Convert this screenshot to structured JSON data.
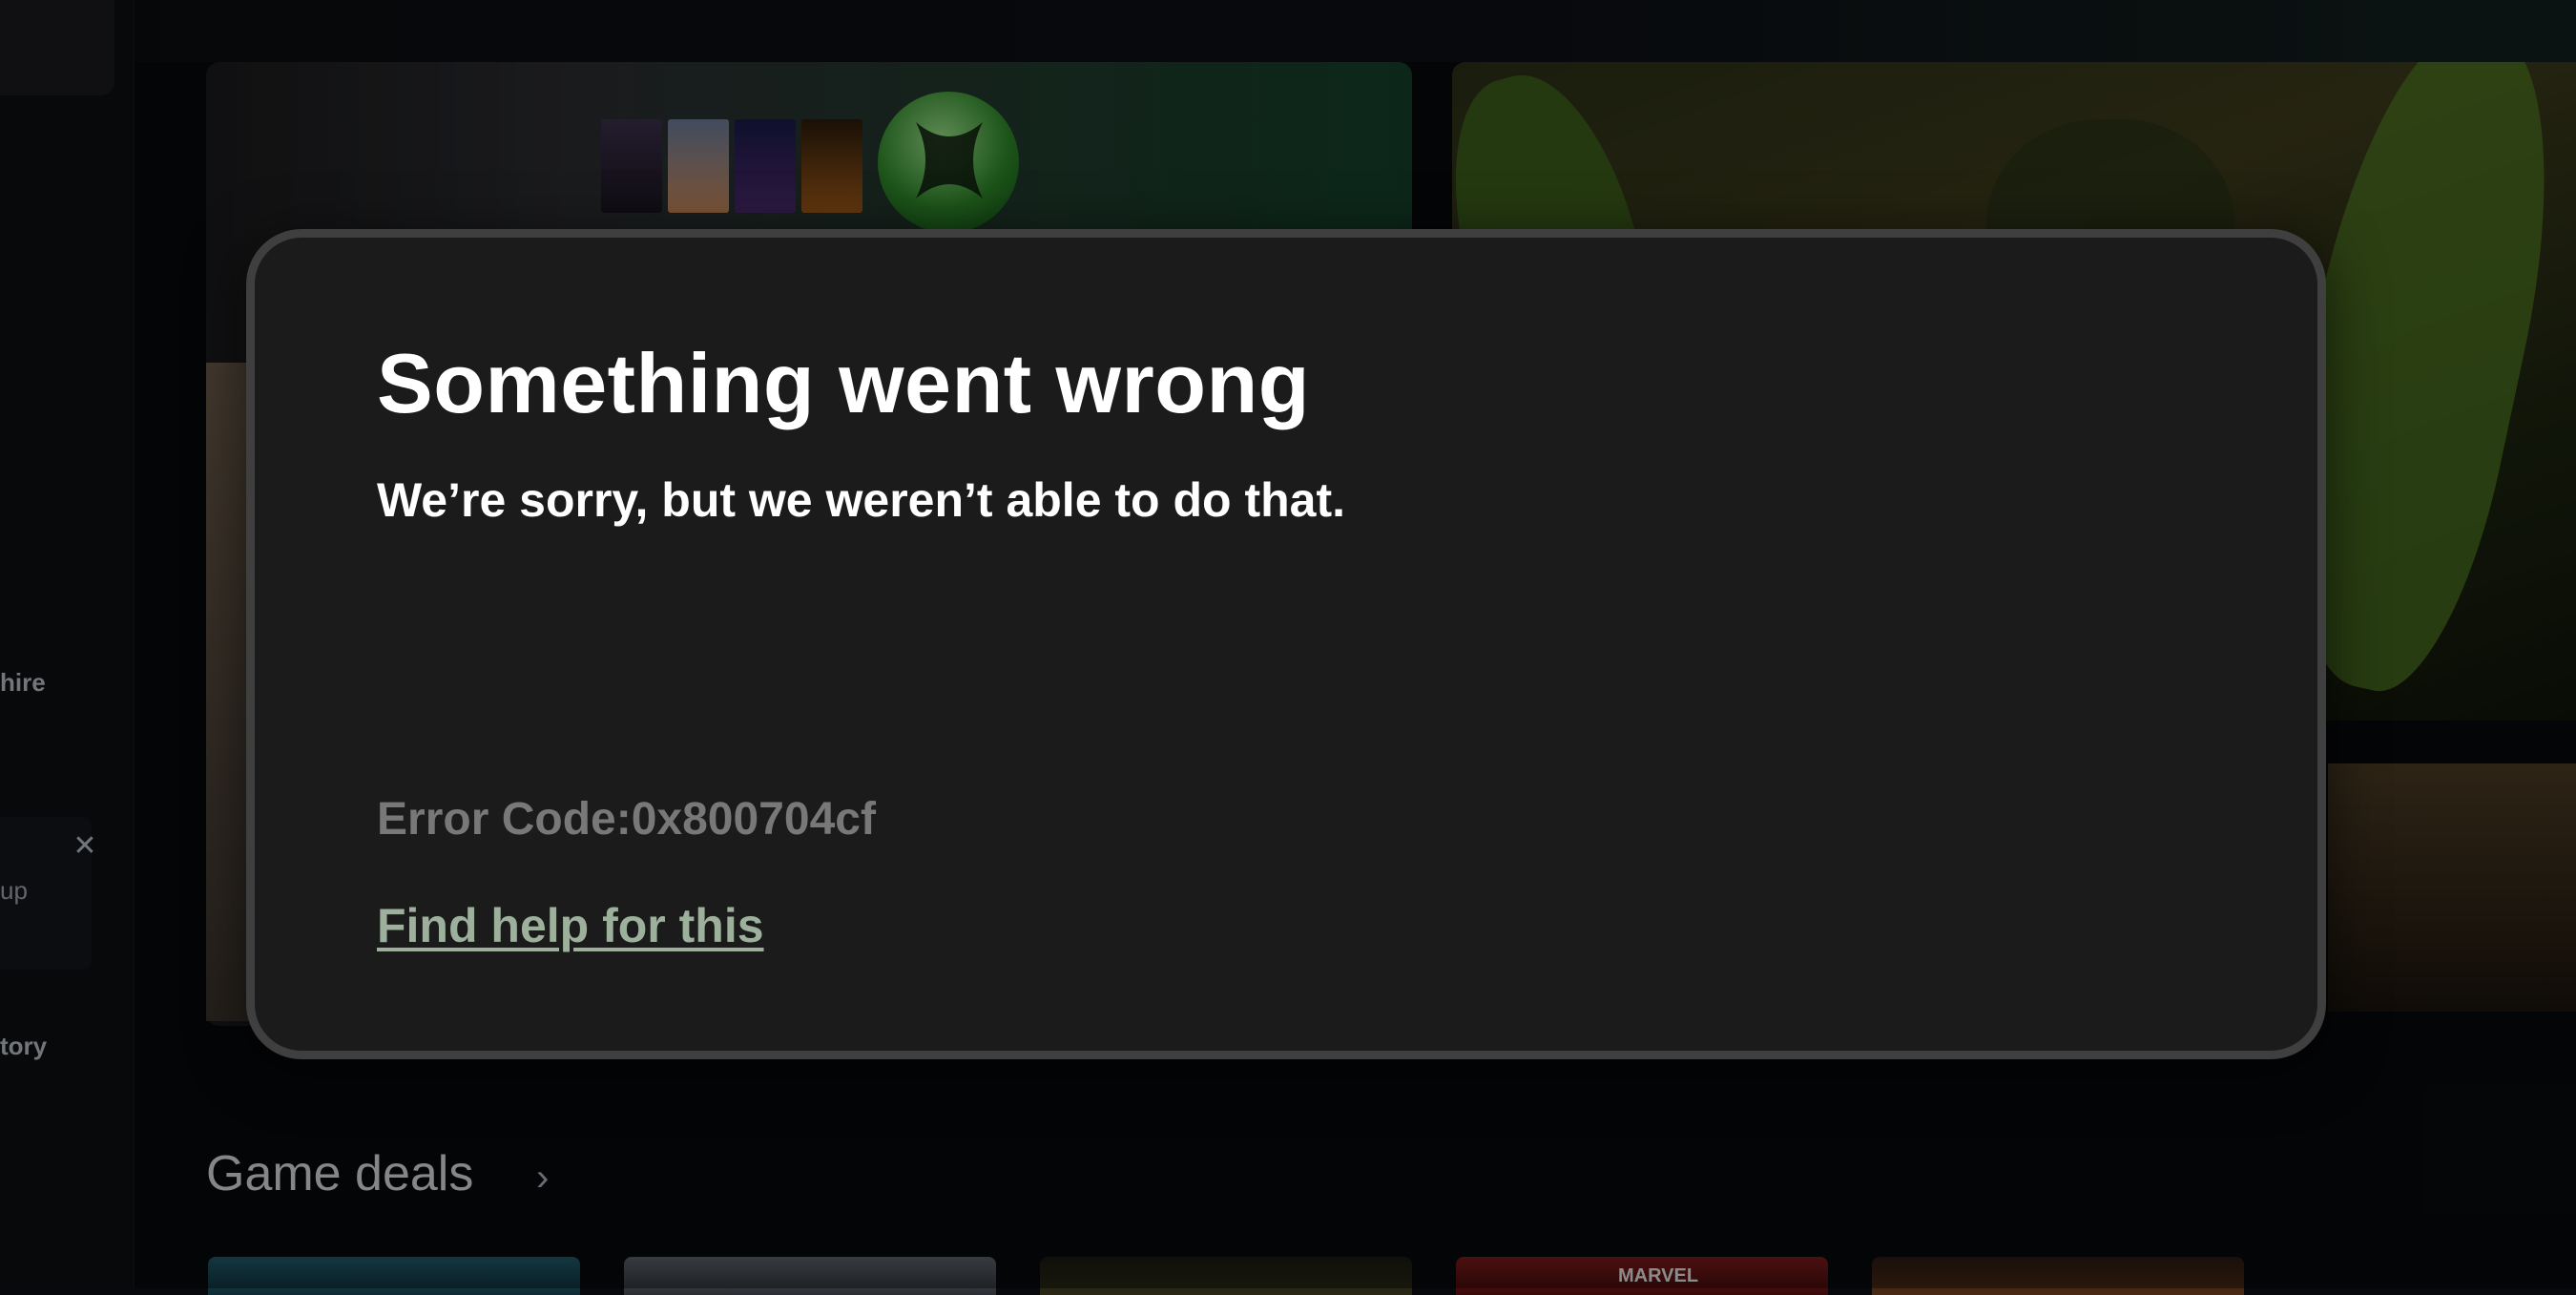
{
  "background": {
    "sidebar": {
      "item_1_label": "hire",
      "card_text": "up",
      "item_3_label": "tory"
    },
    "section": {
      "title": "Game deals",
      "arrow_icon": "chevron-right-icon"
    },
    "deals_marvel_label": "MARVEL"
  },
  "dialog": {
    "title": "Something went wrong",
    "message": "We’re sorry, but we weren’t able to do that.",
    "error_code": "Error Code:0x800704cf",
    "help_link": "Find help for this"
  },
  "colors": {
    "dialog_bg": "#1b1b1b",
    "dialog_border": "#3f3f3f",
    "error_text": "#787878",
    "help_link": "#9cb09c",
    "xbox_green": "#2f8a2a"
  }
}
